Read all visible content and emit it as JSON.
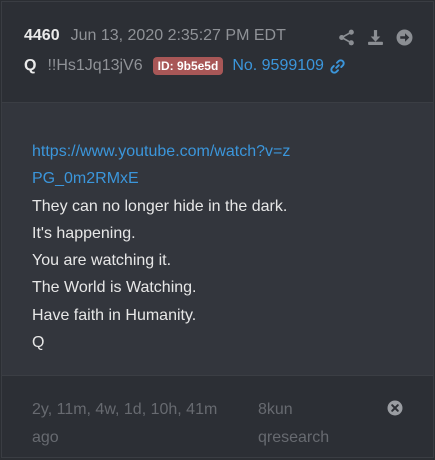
{
  "post": {
    "number": "4460",
    "timestamp": "Jun 13, 2020 2:35:27 PM EDT",
    "author": "Q",
    "tripcode": "!!Hs1Jq13jV6",
    "id_badge": "ID: 9b5e5d",
    "post_ref": "No. 9599109"
  },
  "icons": {
    "share": "share-icon",
    "download": "download-icon",
    "goto": "arrow-right-circle-icon",
    "link": "link-icon",
    "close": "close-circle-icon"
  },
  "body": {
    "link_text": "https://www.youtube.com/watch?v=zPG_0m2RMxE",
    "lines": [
      "They can no longer hide in the dark.",
      "It's happening.",
      "You are watching it.",
      "The World is Watching.",
      "Have faith in Humanity.",
      "Q"
    ]
  },
  "footer": {
    "age": "2y, 11m, 4w, 1d, 10h, 41m ago",
    "site": "8kun",
    "board": "qresearch"
  },
  "colors": {
    "background": "#33363d",
    "header": "#2c2f35",
    "link": "#3b96db",
    "badge": "#a85757",
    "muted": "#8f9297"
  }
}
